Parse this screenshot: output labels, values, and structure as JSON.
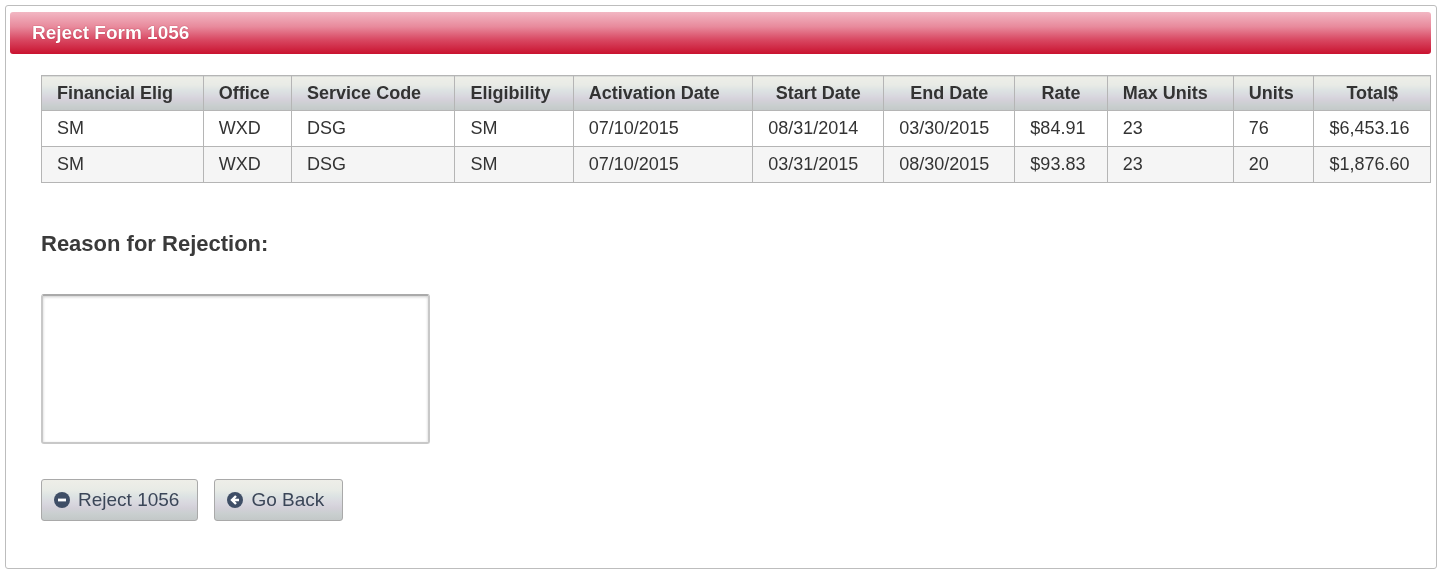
{
  "panel": {
    "title": "Reject Form 1056"
  },
  "table": {
    "columns": [
      "Financial Elig",
      "Office",
      "Service Code",
      "Eligibility",
      "Activation Date",
      "Start Date",
      "End Date",
      "Rate",
      "Max Units",
      "Units",
      "Total$"
    ],
    "rows": [
      [
        "SM",
        "WXD",
        "DSG",
        "SM",
        "07/10/2015",
        "08/31/2014",
        "03/30/2015",
        "$84.91",
        "23",
        "76",
        "$6,453.16"
      ],
      [
        "SM",
        "WXD",
        "DSG",
        "SM",
        "07/10/2015",
        "03/31/2015",
        "08/30/2015",
        "$93.83",
        "23",
        "20",
        "$1,876.60"
      ]
    ]
  },
  "reason": {
    "label": "Reason for Rejection:"
  },
  "buttons": [
    {
      "label": "Reject 1056",
      "kind": "reject"
    },
    {
      "label": "Go Back",
      "kind": "back"
    }
  ]
}
